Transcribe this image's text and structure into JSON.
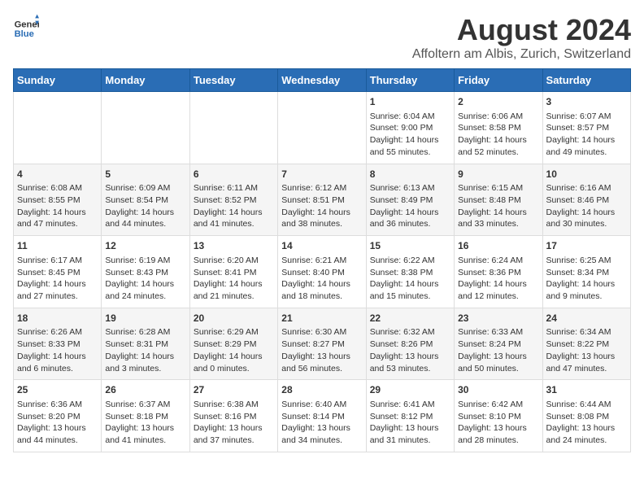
{
  "header": {
    "logo_general": "General",
    "logo_blue": "Blue",
    "title": "August 2024",
    "subtitle": "Affoltern am Albis, Zurich, Switzerland"
  },
  "days_of_week": [
    "Sunday",
    "Monday",
    "Tuesday",
    "Wednesday",
    "Thursday",
    "Friday",
    "Saturday"
  ],
  "weeks": [
    {
      "alt": false,
      "days": [
        {
          "num": "",
          "content": ""
        },
        {
          "num": "",
          "content": ""
        },
        {
          "num": "",
          "content": ""
        },
        {
          "num": "",
          "content": ""
        },
        {
          "num": "1",
          "content": "Sunrise: 6:04 AM\nSunset: 9:00 PM\nDaylight: 14 hours and 55 minutes."
        },
        {
          "num": "2",
          "content": "Sunrise: 6:06 AM\nSunset: 8:58 PM\nDaylight: 14 hours and 52 minutes."
        },
        {
          "num": "3",
          "content": "Sunrise: 6:07 AM\nSunset: 8:57 PM\nDaylight: 14 hours and 49 minutes."
        }
      ]
    },
    {
      "alt": true,
      "days": [
        {
          "num": "4",
          "content": "Sunrise: 6:08 AM\nSunset: 8:55 PM\nDaylight: 14 hours and 47 minutes."
        },
        {
          "num": "5",
          "content": "Sunrise: 6:09 AM\nSunset: 8:54 PM\nDaylight: 14 hours and 44 minutes."
        },
        {
          "num": "6",
          "content": "Sunrise: 6:11 AM\nSunset: 8:52 PM\nDaylight: 14 hours and 41 minutes."
        },
        {
          "num": "7",
          "content": "Sunrise: 6:12 AM\nSunset: 8:51 PM\nDaylight: 14 hours and 38 minutes."
        },
        {
          "num": "8",
          "content": "Sunrise: 6:13 AM\nSunset: 8:49 PM\nDaylight: 14 hours and 36 minutes."
        },
        {
          "num": "9",
          "content": "Sunrise: 6:15 AM\nSunset: 8:48 PM\nDaylight: 14 hours and 33 minutes."
        },
        {
          "num": "10",
          "content": "Sunrise: 6:16 AM\nSunset: 8:46 PM\nDaylight: 14 hours and 30 minutes."
        }
      ]
    },
    {
      "alt": false,
      "days": [
        {
          "num": "11",
          "content": "Sunrise: 6:17 AM\nSunset: 8:45 PM\nDaylight: 14 hours and 27 minutes."
        },
        {
          "num": "12",
          "content": "Sunrise: 6:19 AM\nSunset: 8:43 PM\nDaylight: 14 hours and 24 minutes."
        },
        {
          "num": "13",
          "content": "Sunrise: 6:20 AM\nSunset: 8:41 PM\nDaylight: 14 hours and 21 minutes."
        },
        {
          "num": "14",
          "content": "Sunrise: 6:21 AM\nSunset: 8:40 PM\nDaylight: 14 hours and 18 minutes."
        },
        {
          "num": "15",
          "content": "Sunrise: 6:22 AM\nSunset: 8:38 PM\nDaylight: 14 hours and 15 minutes."
        },
        {
          "num": "16",
          "content": "Sunrise: 6:24 AM\nSunset: 8:36 PM\nDaylight: 14 hours and 12 minutes."
        },
        {
          "num": "17",
          "content": "Sunrise: 6:25 AM\nSunset: 8:34 PM\nDaylight: 14 hours and 9 minutes."
        }
      ]
    },
    {
      "alt": true,
      "days": [
        {
          "num": "18",
          "content": "Sunrise: 6:26 AM\nSunset: 8:33 PM\nDaylight: 14 hours and 6 minutes."
        },
        {
          "num": "19",
          "content": "Sunrise: 6:28 AM\nSunset: 8:31 PM\nDaylight: 14 hours and 3 minutes."
        },
        {
          "num": "20",
          "content": "Sunrise: 6:29 AM\nSunset: 8:29 PM\nDaylight: 14 hours and 0 minutes."
        },
        {
          "num": "21",
          "content": "Sunrise: 6:30 AM\nSunset: 8:27 PM\nDaylight: 13 hours and 56 minutes."
        },
        {
          "num": "22",
          "content": "Sunrise: 6:32 AM\nSunset: 8:26 PM\nDaylight: 13 hours and 53 minutes."
        },
        {
          "num": "23",
          "content": "Sunrise: 6:33 AM\nSunset: 8:24 PM\nDaylight: 13 hours and 50 minutes."
        },
        {
          "num": "24",
          "content": "Sunrise: 6:34 AM\nSunset: 8:22 PM\nDaylight: 13 hours and 47 minutes."
        }
      ]
    },
    {
      "alt": false,
      "days": [
        {
          "num": "25",
          "content": "Sunrise: 6:36 AM\nSunset: 8:20 PM\nDaylight: 13 hours and 44 minutes."
        },
        {
          "num": "26",
          "content": "Sunrise: 6:37 AM\nSunset: 8:18 PM\nDaylight: 13 hours and 41 minutes."
        },
        {
          "num": "27",
          "content": "Sunrise: 6:38 AM\nSunset: 8:16 PM\nDaylight: 13 hours and 37 minutes."
        },
        {
          "num": "28",
          "content": "Sunrise: 6:40 AM\nSunset: 8:14 PM\nDaylight: 13 hours and 34 minutes."
        },
        {
          "num": "29",
          "content": "Sunrise: 6:41 AM\nSunset: 8:12 PM\nDaylight: 13 hours and 31 minutes."
        },
        {
          "num": "30",
          "content": "Sunrise: 6:42 AM\nSunset: 8:10 PM\nDaylight: 13 hours and 28 minutes."
        },
        {
          "num": "31",
          "content": "Sunrise: 6:44 AM\nSunset: 8:08 PM\nDaylight: 13 hours and 24 minutes."
        }
      ]
    }
  ]
}
